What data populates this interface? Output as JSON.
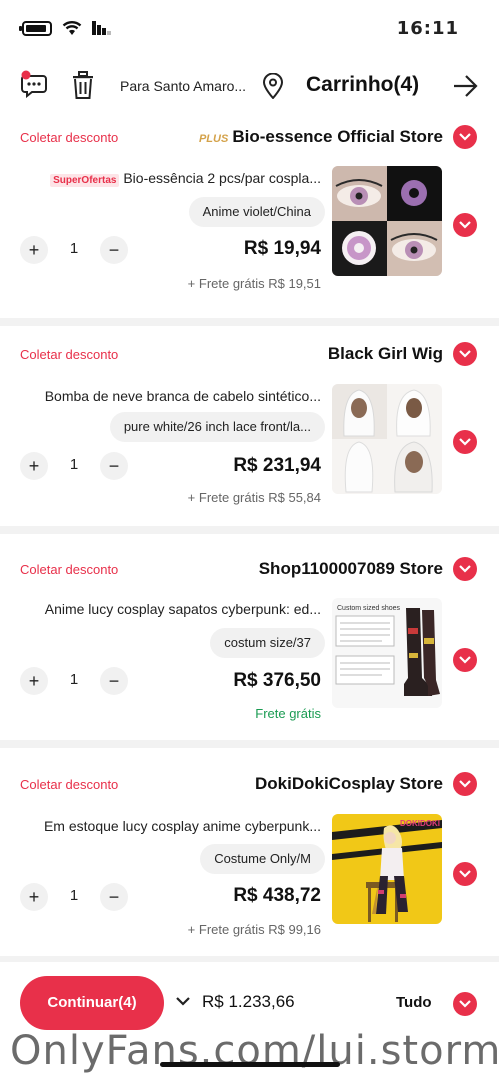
{
  "status_bar": {
    "time": "16:11"
  },
  "header": {
    "title": "Carrinho(4)",
    "location": "Para Santo Amaro..."
  },
  "stores": [
    {
      "badge": "PLUS",
      "name": "Bio-essence Official Store",
      "coupon": "Coletar desconto",
      "item": {
        "promo": "SuperOfertas",
        "title": "Bio-essência 2 pcs/par cospla...",
        "sku": "Anime violet/China",
        "price": "R$ 19,94",
        "qty": "1",
        "shipping": "+ Frete grátis R$ 19,51"
      }
    },
    {
      "name": "Black Girl Wig",
      "coupon": "Coletar desconto",
      "item": {
        "title": "Bomba de neve branca de cabelo sintético...",
        "sku": "pure white/26 inch lace front/la...",
        "price": "R$ 231,94",
        "qty": "1",
        "shipping": "+ Frete grátis R$ 55,84"
      }
    },
    {
      "name": "Shop1100007089 Store",
      "coupon": "Coletar desconto",
      "item": {
        "title": "Anime lucy cosplay sapatos cyberpunk: ed...",
        "sku": "costum size/37",
        "price": "R$ 376,50",
        "qty": "1",
        "shipping": "Frete grátis",
        "image_caption": "Custom sized shoes"
      }
    },
    {
      "name": "DokiDokiCosplay Store",
      "coupon": "Coletar desconto",
      "item": {
        "title": "Em estoque lucy cosplay anime cyberpunk...",
        "sku": "Costume Only/M",
        "price": "R$ 438,72",
        "qty": "1",
        "shipping": "+ Frete grátis R$ 99,16",
        "image_caption": "DOKIDOKI"
      }
    }
  ],
  "footer": {
    "all_label": "Tudo",
    "total": "R$ 1.233,66",
    "checkout_label": "Continuar(4)"
  },
  "watermark": "OnlyFans.com/lui.storm",
  "colors": {
    "accent": "#e8304a",
    "free_shipping": "#1a9b52",
    "plus_badge": "#d4a24a"
  },
  "icons": [
    "battery-icon",
    "wifi-icon",
    "signal-icon",
    "message-icon",
    "trash-icon",
    "location-pin-icon",
    "back-arrow-icon",
    "check-circle-icon",
    "chevron-down-icon"
  ]
}
